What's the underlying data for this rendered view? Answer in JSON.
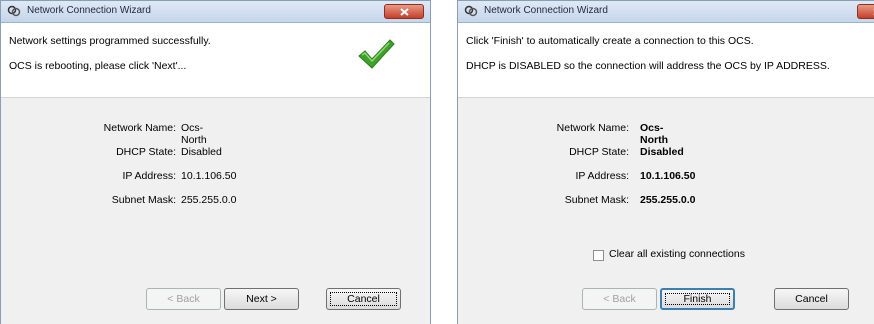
{
  "window1": {
    "title": "Network Connection Wizard",
    "line1": "Network settings programmed successfully.",
    "line2": "OCS is rebooting, please click 'Next'...",
    "fields": [
      {
        "label": "Network Name:",
        "value": "Ocs-North"
      },
      {
        "label": "DHCP State:",
        "value": "Disabled"
      },
      {
        "label": "IP Address:",
        "value": "10.1.106.50"
      },
      {
        "label": "Subnet Mask:",
        "value": "255.255.0.0"
      }
    ],
    "buttons": {
      "back": "< Back",
      "next": "Next >",
      "cancel": "Cancel"
    }
  },
  "window2": {
    "title": "Network Connection Wizard",
    "line1": "Click 'Finish' to automatically create a connection to this OCS.",
    "line2": "DHCP is DISABLED so the connection will address the OCS by IP ADDRESS.",
    "fields": [
      {
        "label": "Network Name:",
        "value": "Ocs-North"
      },
      {
        "label": "DHCP State:",
        "value": "Disabled"
      },
      {
        "label": "IP Address:",
        "value": "10.1.106.50"
      },
      {
        "label": "Subnet Mask:",
        "value": "255.255.0.0"
      }
    ],
    "checkbox_label": "Clear all existing connections",
    "checkbox_checked": false,
    "buttons": {
      "back": "< Back",
      "finish": "Finish",
      "cancel": "Cancel"
    }
  },
  "icons": {
    "app": "network-wizard-icon",
    "close": "close-icon",
    "success": "checkmark-icon"
  },
  "colors": {
    "checkmark": "#3fa02a",
    "close_button": "#c4402a"
  }
}
